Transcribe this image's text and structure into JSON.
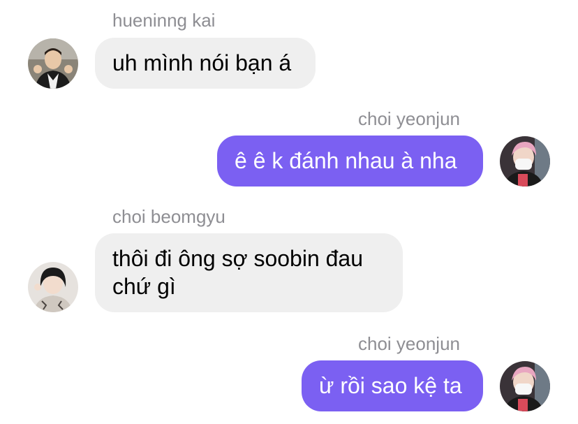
{
  "messages": [
    {
      "sender": "hueninng kai",
      "text": "uh mình nói bạn á",
      "direction": "incoming"
    },
    {
      "sender": "choi yeonjun",
      "text": "ê ê k đánh nhau à nha",
      "direction": "outgoing"
    },
    {
      "sender": "choi beomgyu",
      "text": "thôi đi ông sợ soobin đau\nchứ gì",
      "direction": "incoming"
    },
    {
      "sender": "choi yeonjun",
      "text": "ừ rồi sao kệ ta",
      "direction": "outgoing"
    }
  ],
  "colors": {
    "outgoing_bubble": "#7b60f2",
    "incoming_bubble": "#efefef",
    "sender_name": "#8e8e93"
  }
}
